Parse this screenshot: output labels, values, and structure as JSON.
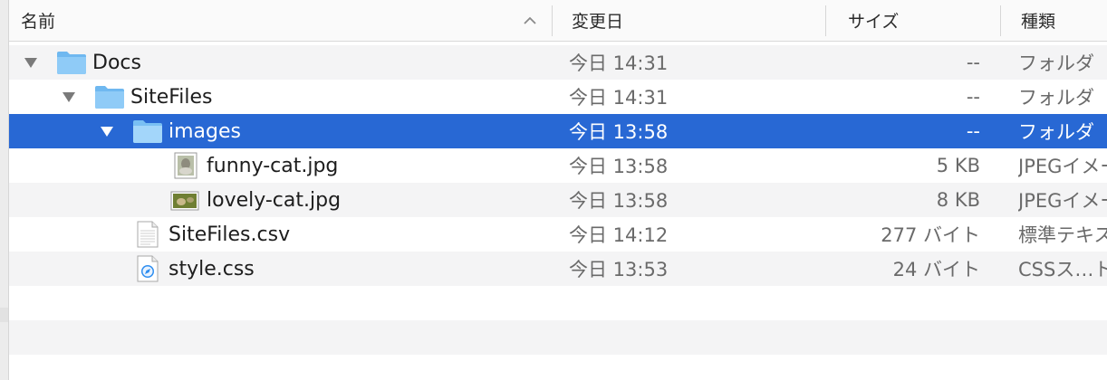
{
  "columns": {
    "name": "名前",
    "date": "変更日",
    "size": "サイズ",
    "kind": "種類"
  },
  "colors": {
    "selection": "#2868d4",
    "folder": "#7ec4f6",
    "alt_row": "#f4f4f5"
  },
  "rows": [
    {
      "name": "Docs",
      "date": "今日 14:31",
      "size": "--",
      "kind": "フォルダ",
      "icon": "folder-icon",
      "expanded": true
    },
    {
      "name": "SiteFiles",
      "date": "今日 14:31",
      "size": "--",
      "kind": "フォルダ",
      "icon": "folder-icon",
      "expanded": true
    },
    {
      "name": "images",
      "date": "今日 13:58",
      "size": "--",
      "kind": "フォルダ",
      "icon": "folder-icon",
      "expanded": true,
      "selected": true
    },
    {
      "name": "funny-cat.jpg",
      "date": "今日 13:58",
      "size": "5 KB",
      "kind": "JPEGイメージ",
      "icon": "jpeg-thumbnail-icon"
    },
    {
      "name": "lovely-cat.jpg",
      "date": "今日 13:58",
      "size": "8 KB",
      "kind": "JPEGイメージ",
      "icon": "jpeg-thumbnail-icon"
    },
    {
      "name": "SiteFiles.csv",
      "date": "今日 14:12",
      "size": "277 バイト",
      "kind": "標準テキスト",
      "icon": "text-document-icon"
    },
    {
      "name": "style.css",
      "date": "今日 13:53",
      "size": "24 バイト",
      "kind": "CSSス…ト",
      "icon": "css-document-icon"
    }
  ]
}
